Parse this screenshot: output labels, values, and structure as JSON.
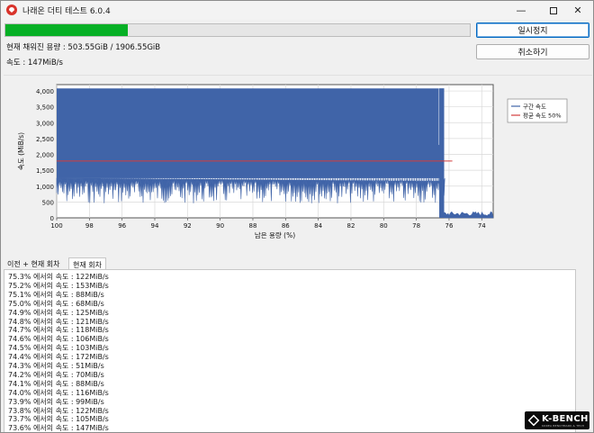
{
  "window": {
    "title": "나래온 더티 테스트 6.0.4",
    "minimize_glyph": "—",
    "close_glyph": "✕"
  },
  "progress": {
    "fraction": 0.264,
    "color": "#06b025"
  },
  "buttons": {
    "pause_label": "일시정지",
    "cancel_label": "취소하기"
  },
  "status": {
    "fill_text": "현재 채워진 용량 : 503.55GiB / 1906.55GiB",
    "speed_text": "속도 : 147MiB/s"
  },
  "chart_data": {
    "type": "area",
    "xlabel": "남은 용량 (%)",
    "ylabel": "속도 (MiB/s)",
    "xlim": [
      100,
      73.3
    ],
    "ylim": [
      0,
      4200
    ],
    "x_ticks": [
      "100",
      "98",
      "96",
      "94",
      "92",
      "90",
      "88",
      "86",
      "84",
      "82",
      "80",
      "78",
      "76",
      "74"
    ],
    "y_ticks": [
      "0",
      "500",
      "1,000",
      "1,500",
      "2,000",
      "2,500",
      "3,000",
      "3,500",
      "4,000"
    ],
    "grid": true,
    "legend_position": "right",
    "series": [
      {
        "name": "구간 속도",
        "color": "#4064a8",
        "band_high": 4080,
        "band_low_points": [
          [
            100,
            1250
          ],
          [
            76.3,
            1150
          ]
        ],
        "x": [
          76.3,
          76.1,
          75.9,
          75.5,
          75.0,
          74.5,
          74.0,
          73.6
        ],
        "values": [
          80,
          160,
          160,
          130,
          160,
          140,
          120,
          147
        ]
      },
      {
        "name": "평균 속도 50%",
        "color": "#d23c3c",
        "x": [
          100,
          75.8
        ],
        "values": [
          1790,
          1790
        ]
      }
    ]
  },
  "tabs": {
    "history_label": "이전 + 현재 회차",
    "current_label": "현재 회차"
  },
  "log_lines": [
    "75.3% 에서의 속도 : 122MiB/s",
    "75.2% 에서의 속도 : 153MiB/s",
    "75.1% 에서의 속도 : 88MiB/s",
    "75.0% 에서의 속도 : 68MiB/s",
    "74.9% 에서의 속도 : 125MiB/s",
    "74.8% 에서의 속도 : 121MiB/s",
    "74.7% 에서의 속도 : 118MiB/s",
    "74.6% 에서의 속도 : 106MiB/s",
    "74.5% 에서의 속도 : 103MiB/s",
    "74.4% 에서의 속도 : 172MiB/s",
    "74.3% 에서의 속도 : 51MiB/s",
    "74.2% 에서의 속도 : 70MiB/s",
    "74.1% 에서의 속도 : 88MiB/s",
    "74.0% 에서의 속도 : 116MiB/s",
    "73.9% 에서의 속도 : 99MiB/s",
    "73.8% 에서의 속도 : 122MiB/s",
    "73.7% 에서의 속도 : 105MiB/s",
    "73.6% 에서의 속도 : 147MiB/s"
  ],
  "watermark": {
    "brand": "K-BENCH",
    "tagline": "KOREA BENCHMARK & TECH"
  }
}
